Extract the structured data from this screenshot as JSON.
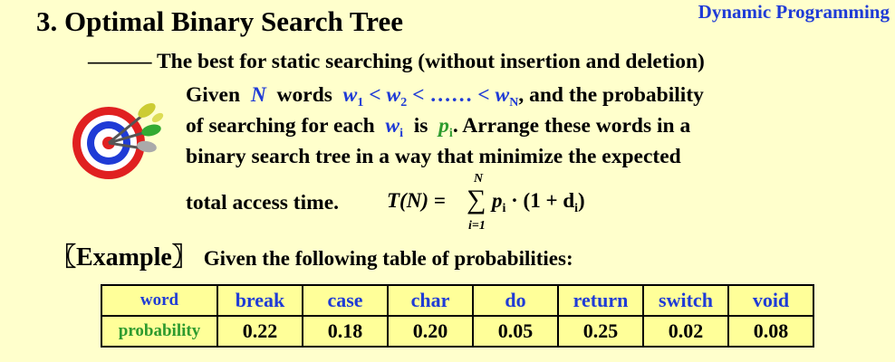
{
  "header": {
    "title": "3.  Optimal Binary Search Tree",
    "domain": "Dynamic Programming"
  },
  "intro": {
    "dash": "———",
    "subtitle": "The best for static searching (without insertion and deletion)"
  },
  "problem": {
    "line1": {
      "given": "Given",
      "N": "N",
      "words": "words",
      "w": "w",
      "sub1": "1",
      "lt1": "<",
      "sub2": "2",
      "lt2": "< ……  <",
      "subN": "N",
      "tail": ", and the probability"
    },
    "line2": {
      "pre": "of searching for each",
      "w": "w",
      "subi": "i",
      "is": "is",
      "p": "p",
      "psub": "i",
      "tail": ".  Arrange these words in a"
    },
    "line3": "binary search tree in a way that minimize the expected",
    "line4": "total access time.",
    "formula": {
      "lhs": "T(N) =",
      "upper": "N",
      "lower": "i=1",
      "term": "p",
      "term_sub": "i",
      "rest": "· (1 + d",
      "rest_sub": "i",
      "close": ")"
    }
  },
  "example": {
    "label": "〖Example〗",
    "text": "Given the following table of probabilities:"
  },
  "table": {
    "row_heads": [
      "word",
      "probability"
    ],
    "words": [
      "break",
      "case",
      "char",
      "do",
      "return",
      "switch",
      "void"
    ],
    "probabilities": [
      "0.22",
      "0.18",
      "0.20",
      "0.05",
      "0.25",
      "0.02",
      "0.08"
    ]
  },
  "colors": {
    "background": "#ffffcc",
    "accent_blue": "#1f3bd6",
    "accent_green": "#2e9b2e",
    "table_fill": "#ffff99",
    "target_red": "#e02020"
  },
  "icons": [
    "dartboard-target-icon"
  ]
}
